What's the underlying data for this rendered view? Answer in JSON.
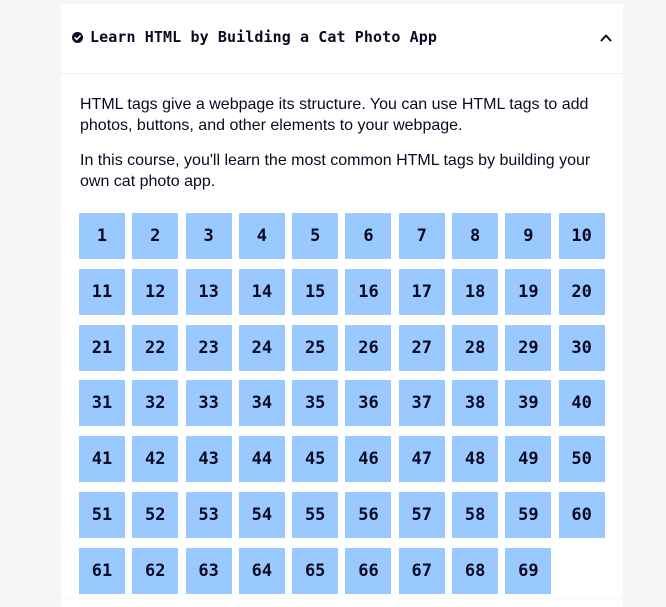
{
  "header": {
    "title": "Learn HTML by Building a Cat Photo App",
    "status_icon": "check-circle-icon",
    "toggle_icon": "chevron-up-icon"
  },
  "description": [
    "HTML tags give a webpage its structure. You can use HTML tags to add photos, buttons, and other elements to your webpage.",
    "In this course, you'll learn the most common HTML tags by building your own cat photo app."
  ],
  "steps": [
    "1",
    "2",
    "3",
    "4",
    "5",
    "6",
    "7",
    "8",
    "9",
    "10",
    "11",
    "12",
    "13",
    "14",
    "15",
    "16",
    "17",
    "18",
    "19",
    "20",
    "21",
    "22",
    "23",
    "24",
    "25",
    "26",
    "27",
    "28",
    "29",
    "30",
    "31",
    "32",
    "33",
    "34",
    "35",
    "36",
    "37",
    "38",
    "39",
    "40",
    "41",
    "42",
    "43",
    "44",
    "45",
    "46",
    "47",
    "48",
    "49",
    "50",
    "51",
    "52",
    "53",
    "54",
    "55",
    "56",
    "57",
    "58",
    "59",
    "60",
    "61",
    "62",
    "63",
    "64",
    "65",
    "66",
    "67",
    "68",
    "69"
  ],
  "colors": {
    "step_background": "#99c9ff",
    "text": "#0a0a23",
    "page_background": "#f5f6f7",
    "card_background": "#ffffff"
  }
}
